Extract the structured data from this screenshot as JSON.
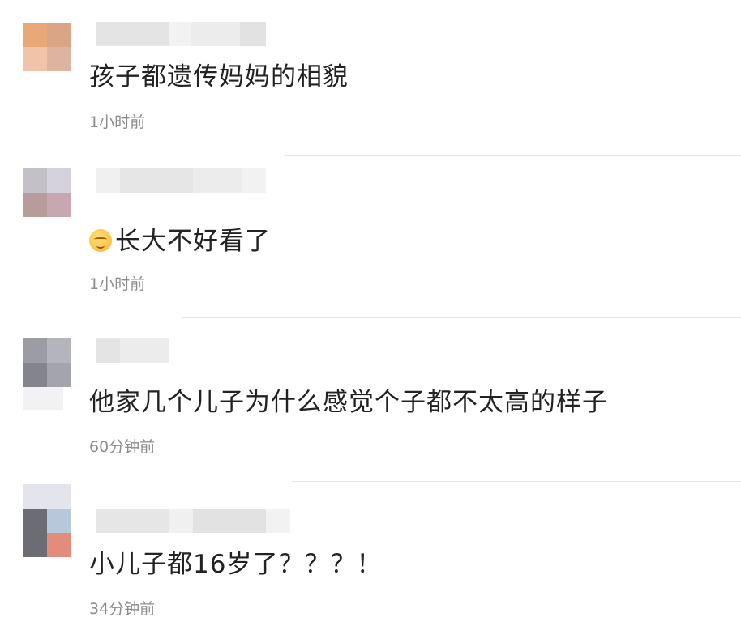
{
  "comments": [
    {
      "text": "孩子都遗传妈妈的相貌",
      "time": "1小时前",
      "avatar_colors": [
        "#e8a878",
        "#d9a584",
        "#f0c4a8",
        "#dcb4a0"
      ],
      "has_emoji": false
    },
    {
      "text": "长大不好看了",
      "time": "1小时前",
      "avatar_colors": [
        "#c4c0c8",
        "#d6d2dc",
        "#b89c9c",
        "#c8a8b0"
      ],
      "has_emoji": true,
      "emoji_icon": "grimace-face-icon"
    },
    {
      "text": "他家几个儿子为什么感觉个子都不太高的样子",
      "time": "60分钟前",
      "avatar_colors": [
        "#9c9ca4",
        "#b4b4bc",
        "#84848c",
        "#a4a4ac"
      ],
      "has_emoji": false
    },
    {
      "text": "小儿子都16岁了？？？！",
      "time": "34分钟前",
      "avatar_colors": [
        "#e4e4ec",
        "#b8c8dc",
        "#6c6c74",
        "#e48c7c"
      ],
      "has_emoji": false
    }
  ]
}
